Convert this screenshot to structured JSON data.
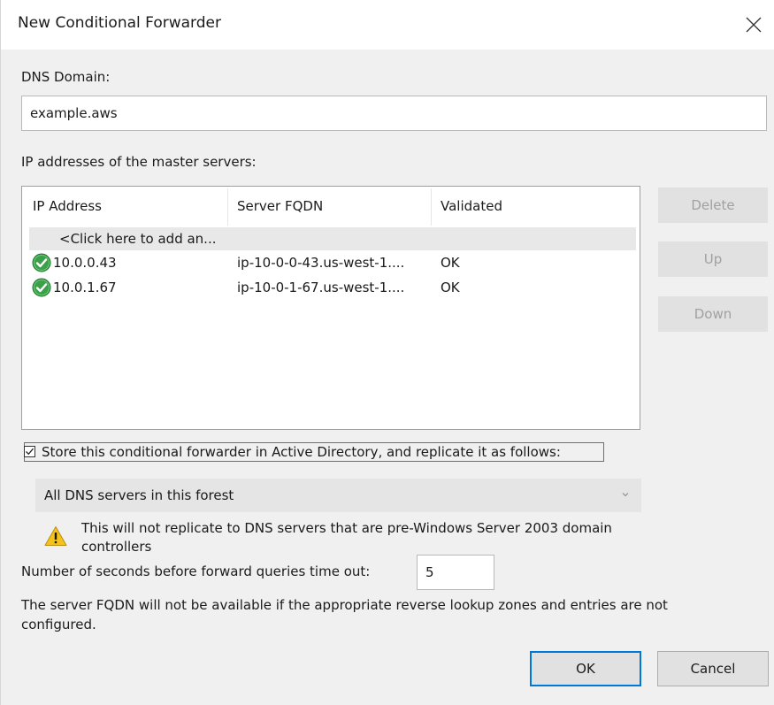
{
  "window": {
    "title": "New Conditional Forwarder"
  },
  "dns_domain": {
    "label": "DNS Domain:",
    "value": "example.aws"
  },
  "master_servers": {
    "label": "IP addresses of the master servers:",
    "columns": [
      "IP Address",
      "Server FQDN",
      "Validated"
    ],
    "add_row_text": "<Click here to add an...",
    "rows": [
      {
        "ip": "10.0.0.43",
        "fqdn": "ip-10-0-0-43.us-west-1....",
        "validated": "OK",
        "icon": "green-check-icon"
      },
      {
        "ip": "10.0.1.67",
        "fqdn": "ip-10-0-1-67.us-west-1....",
        "validated": "OK",
        "icon": "green-check-icon"
      }
    ]
  },
  "side_buttons": {
    "delete": "Delete",
    "up": "Up",
    "down": "Down"
  },
  "store_ad": {
    "checked": true,
    "label": "Store this conditional forwarder in Active Directory, and replicate it as follows:"
  },
  "replication": {
    "selected": "All DNS servers in this forest",
    "warning": "This will not replicate to DNS servers that are pre-Windows Server 2003 domain controllers"
  },
  "timeout": {
    "label": "Number of seconds before forward queries time out:",
    "value": "5"
  },
  "note": "The server FQDN will not be available if the appropriate reverse lookup zones and entries are not configured.",
  "buttons": {
    "ok": "OK",
    "cancel": "Cancel"
  },
  "colors": {
    "accent": "#0078d7",
    "check_green": "#3aa14a",
    "warning_yellow": "#f5c21b"
  }
}
